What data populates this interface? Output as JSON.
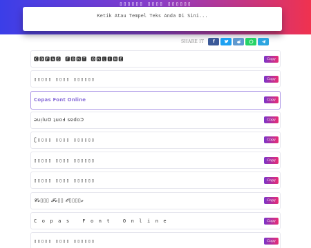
{
  "hero": {
    "title": "▯▯▯▯▯▯ ▯▯▯▯ ▯▯▯▯▯▯"
  },
  "input": {
    "placeholder": "Ketik Atau Tempel Teks Anda Di Sini..."
  },
  "share": {
    "label": "SHARE IT",
    "buttons": [
      {
        "icon": "facebook-icon",
        "color": "#3b5998"
      },
      {
        "icon": "twitter-icon",
        "color": "#1da1f2"
      },
      {
        "icon": "reddit-icon",
        "color": "#5f99cf"
      },
      {
        "icon": "whatsapp-icon",
        "color": "#25d366"
      },
      {
        "icon": "telegram-icon",
        "color": "#2ca5e0"
      }
    ]
  },
  "results": [
    {
      "text": "🅲🅾🅿🅰🆂 🅵🅾🅽🆃 🅾🅽🅻🅸🅽🅴",
      "style": "box",
      "copy": "Copy"
    },
    {
      "text": "▯▯▯▯▯ ▯▯▯▯ ▯▯▯▯▯▯",
      "style": "box",
      "copy": "Copy"
    },
    {
      "text": "Copas Font Online",
      "style": "active",
      "copy": "Copy"
    },
    {
      "text": "ǝuᴉluO ʇuoℲ sɐdoƆ",
      "style": "plain",
      "copy": "Copy"
    },
    {
      "text": "ʗ▯▯▯▯ ▯▯▯▯ ▯▯▯▯▯▯",
      "style": "box",
      "copy": "Copy"
    },
    {
      "text": "▯▯▯▯▯ ▯▯▯▯ ▯▯▯▯▯▯",
      "style": "box",
      "copy": "Copy"
    },
    {
      "text": "▯▯▯▯▯ ▯▯▯▯ ▯▯▯▯▯▯",
      "style": "box",
      "copy": "Copy"
    },
    {
      "text": "𝓒𝓸▯▯▯ 𝓕𝓸▯▯ 𝓞▯▯▯▯𝓮",
      "style": "italic",
      "copy": "Copy"
    },
    {
      "text": "Copas Font Online",
      "style": "spaced",
      "copy": "Copy"
    },
    {
      "text": "▯▯▯▯▯ ▯▯▯▯ ▯▯▯▯▯▯",
      "style": "box",
      "copy": "Copy"
    }
  ]
}
